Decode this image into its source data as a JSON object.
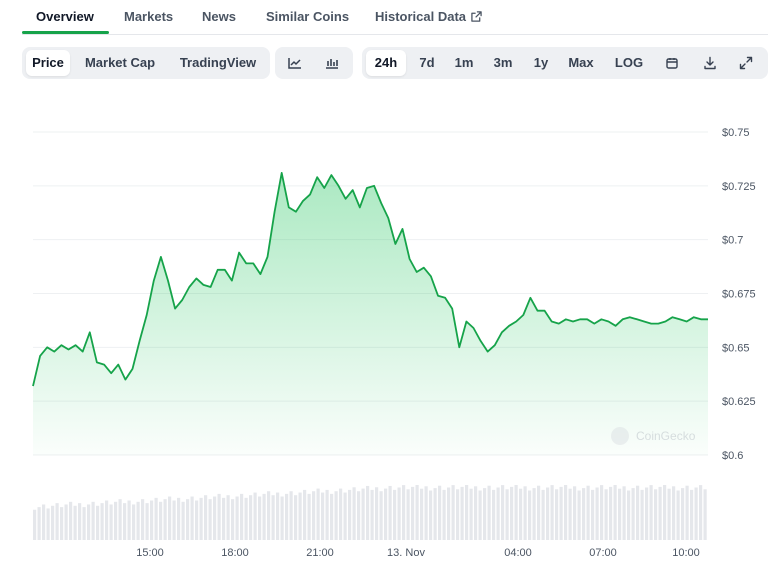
{
  "tabs": [
    {
      "label": "Overview",
      "active": true
    },
    {
      "label": "Markets"
    },
    {
      "label": "News"
    },
    {
      "label": "Similar Coins"
    },
    {
      "label": "Historical Data",
      "icon": "external-link-icon"
    }
  ],
  "toolbar": {
    "metric_buttons": [
      {
        "label": "Price",
        "active": true
      },
      {
        "label": "Market Cap"
      },
      {
        "label": "TradingView"
      }
    ],
    "chart_type_icons": [
      "line-chart-icon",
      "candlestick-chart-icon"
    ],
    "range_buttons": [
      {
        "label": "24h",
        "active": true
      },
      {
        "label": "7d"
      },
      {
        "label": "1m"
      },
      {
        "label": "3m"
      },
      {
        "label": "1y"
      },
      {
        "label": "Max"
      },
      {
        "label": "LOG"
      }
    ],
    "action_icons": [
      "calendar-icon",
      "download-icon",
      "expand-icon"
    ]
  },
  "watermark": "CoinGecko",
  "colors": {
    "line": "#16a34a",
    "area": "#22c55e",
    "volume": "#e5e7eb",
    "accent": "#16a34a"
  },
  "chart_data": {
    "type": "area",
    "series": [
      {
        "x": [
          0,
          0.25,
          0.5,
          0.75,
          1,
          1.25,
          1.5,
          1.75,
          2,
          2.25,
          2.5,
          2.75,
          3,
          3.25,
          3.5,
          3.75,
          4,
          4.25,
          4.5,
          4.75,
          5,
          5.25,
          5.5,
          5.75,
          6,
          6.25,
          6.5,
          6.75,
          7,
          7.25,
          7.5,
          7.75,
          8,
          8.25,
          8.5,
          8.75,
          9,
          9.25,
          9.5,
          9.75,
          10,
          10.25,
          10.5,
          10.75,
          11,
          11.25,
          11.5,
          11.75,
          12,
          12.25,
          12.5,
          12.75,
          13,
          13.25,
          13.5,
          13.75,
          14,
          14.25,
          14.5,
          14.75,
          15,
          15.25,
          15.5,
          15.75,
          16,
          16.25,
          16.5,
          16.75,
          17,
          17.25,
          17.5,
          17.75,
          18,
          18.25,
          18.5,
          18.75,
          19,
          19.25,
          19.5,
          19.75,
          20,
          20.25,
          20.5,
          20.75,
          21,
          21.25,
          21.5,
          21.75,
          22,
          22.25,
          22.5,
          22.75,
          23,
          23.25,
          23.5,
          23.75
        ],
        "values": [
          0.632,
          0.646,
          0.65,
          0.648,
          0.651,
          0.649,
          0.651,
          0.648,
          0.657,
          0.643,
          0.642,
          0.638,
          0.642,
          0.635,
          0.64,
          0.653,
          0.665,
          0.681,
          0.692,
          0.681,
          0.668,
          0.672,
          0.678,
          0.682,
          0.679,
          0.678,
          0.686,
          0.686,
          0.681,
          0.694,
          0.689,
          0.689,
          0.684,
          0.692,
          0.713,
          0.731,
          0.715,
          0.713,
          0.718,
          0.721,
          0.729,
          0.724,
          0.73,
          0.725,
          0.719,
          0.723,
          0.715,
          0.724,
          0.725,
          0.717,
          0.71,
          0.698,
          0.705,
          0.691,
          0.685,
          0.687,
          0.683,
          0.674,
          0.673,
          0.668,
          0.65,
          0.662,
          0.659,
          0.653,
          0.648,
          0.651,
          0.657,
          0.66,
          0.662,
          0.665,
          0.673,
          0.667,
          0.667,
          0.662,
          0.661,
          0.663,
          0.662,
          0.663,
          0.663,
          0.661,
          0.663,
          0.662,
          0.66,
          0.663,
          0.664,
          0.663,
          0.662,
          0.661,
          0.661,
          0.662,
          0.664,
          0.663,
          0.662,
          0.664,
          0.663,
          0.663
        ]
      }
    ],
    "x_tick_labels": [
      "15:00",
      "18:00",
      "21:00",
      "13. Nov",
      "04:00",
      "07:00",
      "10:00"
    ],
    "y_tick_labels": [
      "$0.75",
      "$0.725",
      "$0.7",
      "$0.675",
      "$0.65",
      "$0.625",
      "$0.6"
    ],
    "y_ticks": [
      0.75,
      0.725,
      0.7,
      0.675,
      0.65,
      0.625,
      0.6
    ],
    "ylim": [
      0.6,
      0.75
    ],
    "grid": true,
    "volume_bars": true
  }
}
